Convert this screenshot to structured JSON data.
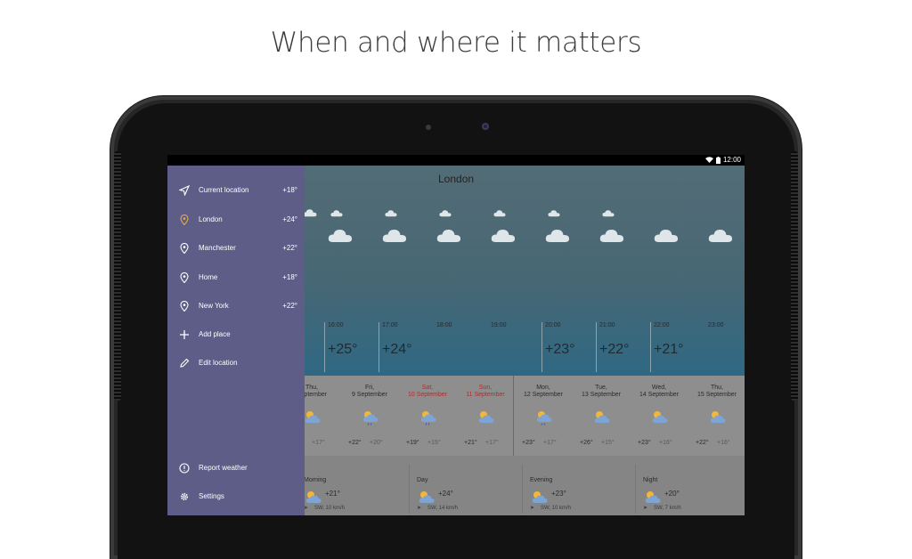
{
  "headline": "When and where it matters",
  "status": {
    "time": "12:00"
  },
  "weather": {
    "city": "London"
  },
  "drawer": {
    "places": [
      {
        "label": "Current location",
        "temp": "+18°",
        "icon": "navigation-arrow-icon"
      },
      {
        "label": "London",
        "temp": "+24°",
        "icon": "location-pin-icon",
        "active": true
      },
      {
        "label": "Manchester",
        "temp": "+22°",
        "icon": "location-pin-icon"
      },
      {
        "label": "Home",
        "temp": "+18°",
        "icon": "location-pin-icon"
      },
      {
        "label": "New York",
        "temp": "+22°",
        "icon": "location-pin-icon"
      }
    ],
    "add_place": "Add place",
    "edit_location": "Edit location",
    "report_weather": "Report weather",
    "settings": "Settings"
  },
  "hourly": [
    {
      "time": "16:00",
      "temp": "+25°"
    },
    {
      "time": "17:00",
      "temp": "+24°"
    },
    {
      "time": "18:00",
      "temp": ""
    },
    {
      "time": "19:00",
      "temp": ""
    },
    {
      "time": "20:00",
      "temp": "+23°"
    },
    {
      "time": "21:00",
      "temp": "+22°"
    },
    {
      "time": "22:00",
      "temp": "+21°"
    },
    {
      "time": "23:00",
      "temp": ""
    }
  ],
  "daily": [
    {
      "day": "Thu,",
      "date": "September",
      "hi": "°",
      "lo": "+17°",
      "weekend": false,
      "icon": "partly-cloudy-icon"
    },
    {
      "day": "Fri,",
      "date": "9 September",
      "hi": "+22°",
      "lo": "+20°",
      "weekend": false,
      "icon": "sun-rain-icon"
    },
    {
      "day": "Sat,",
      "date": "10 September",
      "hi": "+19°",
      "lo": "+15°",
      "weekend": true,
      "icon": "cloud-rain-icon"
    },
    {
      "day": "Sun,",
      "date": "11 September",
      "hi": "+21°",
      "lo": "+17°",
      "weekend": true,
      "icon": "partly-cloudy-icon"
    },
    {
      "day": "Mon,",
      "date": "12 September",
      "hi": "+23°",
      "lo": "+17°",
      "weekend": false,
      "icon": "sun-rain-icon"
    },
    {
      "day": "Tue,",
      "date": "13 September",
      "hi": "+26°",
      "lo": "+15°",
      "weekend": false,
      "icon": "partly-cloudy-icon"
    },
    {
      "day": "Wed,",
      "date": "14 September",
      "hi": "+23°",
      "lo": "+16°",
      "weekend": false,
      "icon": "partly-cloudy-icon"
    },
    {
      "day": "Thu,",
      "date": "15 September",
      "hi": "+22°",
      "lo": "+16°",
      "weekend": false,
      "icon": "partly-cloudy-icon"
    }
  ],
  "day_parts": [
    {
      "name": "Morning",
      "temp": "+21°",
      "wind": "SW, 10 km/h"
    },
    {
      "name": "Day",
      "temp": "+24°",
      "wind": "SW, 14 km/h"
    },
    {
      "name": "Evening",
      "temp": "+23°",
      "wind": "SW, 10 km/h"
    },
    {
      "name": "Night",
      "temp": "+20°",
      "wind": "SW, 7 km/h"
    }
  ],
  "colors": {
    "drawer": "#5d5d87",
    "weekend": "#b42b2b",
    "sky_top": "#536c76",
    "sky_bottom": "#2f6884"
  }
}
